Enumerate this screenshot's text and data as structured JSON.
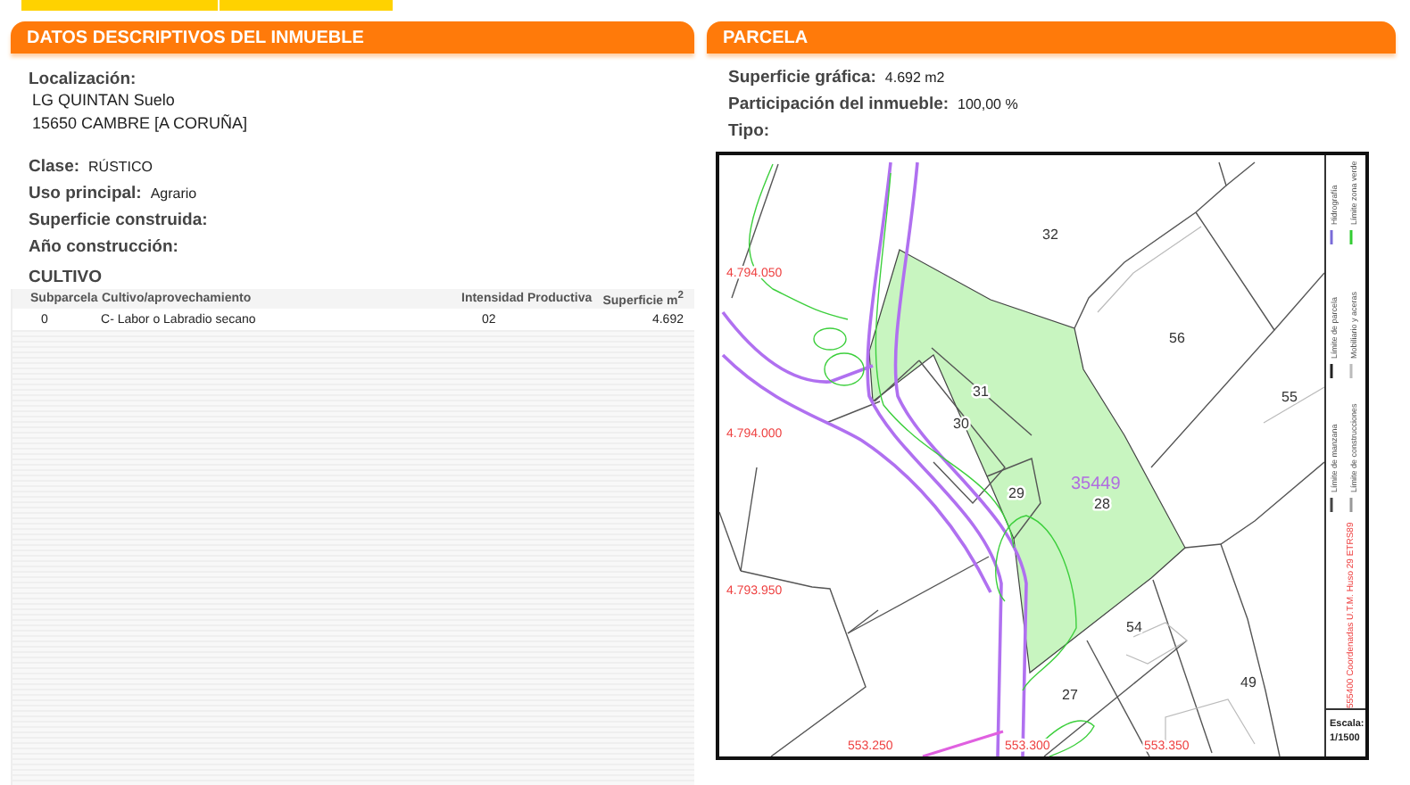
{
  "descriptive": {
    "title": "DATOS DESCRIPTIVOS DEL INMUEBLE",
    "location_label": "Localización:",
    "location_lines": [
      "LG QUINTAN  Suelo",
      "15650 CAMBRE [A CORUÑA]"
    ],
    "fields": [
      {
        "label": "Clase:",
        "value": "RÚSTICO"
      },
      {
        "label": "Uso principal:",
        "value": "Agrario"
      },
      {
        "label": "Superficie construida:"
      },
      {
        "label": "Año construcción:"
      }
    ],
    "cultivo": {
      "title": "CULTIVO",
      "columns": [
        "Subparcela",
        "Cultivo/aprovechamiento",
        "Intensidad Productiva",
        "Superficie m$^{2}$"
      ],
      "rows": [
        [
          "0",
          "C- Labor o Labradio secano",
          "02",
          "4.692"
        ]
      ]
    }
  },
  "parcel": {
    "title": "PARCELA",
    "fields": [
      {
        "label": "Superficie gráfica:",
        "value": "4.692 m2"
      },
      {
        "label": "Participación del inmueble:",
        "value": "100,00 %"
      },
      {
        "label": "Tipo:"
      }
    ],
    "map": {
      "reference": "35449",
      "parcels": [
        "32",
        "56",
        "55",
        "31",
        "30",
        "29",
        "28",
        "54",
        "27",
        "49"
      ],
      "y_coords": [
        "4.794.050",
        "4.794.000",
        "4.793.950"
      ],
      "x_coords": [
        "553.250",
        "553.300",
        "553.350"
      ],
      "legend": [
        "Límite de manzana",
        "Límite de construcciones",
        "Límite de parcela",
        "Mobiliario y aceras",
        "Hidrografía",
        "Límite zona verde"
      ],
      "crs": "555400 Coordenadas U.T.M. Huso 29 ETRS89",
      "scale_label": "Escala:",
      "scale": "1/1500"
    }
  }
}
